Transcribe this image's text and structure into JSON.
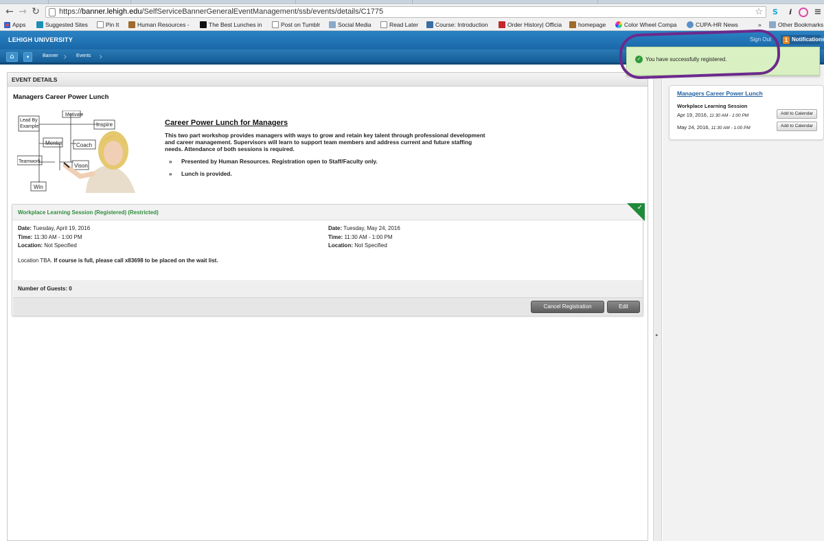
{
  "browser": {
    "url_prefix": "https://",
    "url_host": "banner.lehigh.edu",
    "url_path": "/SelfServiceBannerGeneralEventManagement/ssb/events/details/C1775",
    "bookmarks": [
      "Apps",
      "Suggested Sites",
      "Pin It",
      "Human Resources -",
      "The Best Lunches in",
      "Post on Tumblr",
      "Social Media",
      "Read Later",
      "Course: Introduction",
      "Order History| Officia",
      "homepage",
      "Color Wheel Compa",
      "CUPA-HR News"
    ],
    "overflow": "»",
    "other_bookmarks": "Other Bookmarks"
  },
  "header": {
    "brand": "LEHIGH UNIVERSITY",
    "signout": "Sign Out",
    "notification_count": "1",
    "notifications_label": "Notifications",
    "crumbs": [
      "Banner",
      "Events"
    ]
  },
  "notification": {
    "message": "You have successfully registered."
  },
  "panel": {
    "title": "EVENT DETAILS",
    "event_name": "Managers Career Power Lunch",
    "image_words": [
      "Motivate",
      "Lead By",
      "Example",
      "Inspire",
      "Mentor",
      "Coach",
      "Teamwork",
      "Vison",
      "Win"
    ],
    "promo": {
      "heading": "Career Power Lunch for Managers",
      "description": "This two part workshop provides managers with ways to grow and retain key talent through professional development and career management. Supervisors will learn to support team members and address current and future staffing needs. Attendance of both sessions is required.",
      "bullets": [
        "Presented by Human Resources. Registration open to Staff/Faculty only.",
        "Lunch is provided."
      ]
    }
  },
  "session": {
    "header": "Workplace Learning Session (Registered) (Restricted)",
    "labels": {
      "date": "Date:",
      "time": "Time:",
      "location": "Location:"
    },
    "meetings": [
      {
        "date": "Tuesday, April 19, 2016",
        "time": "11:30 AM - 1:00 PM",
        "location": "Not Specified"
      },
      {
        "date": "Tuesday, May 24, 2016",
        "time": "11:30 AM - 1:00 PM",
        "location": "Not Specified"
      }
    ],
    "note_plain": "Location TBA.",
    "note_bold": "If course is full, please call x83698 to be placed on the wait list.",
    "guests": "Number of Guests: 0",
    "cancel_label": "Cancel Registration",
    "edit_label": "Edit"
  },
  "sidebar": {
    "title": "Managers Career Power Lunch",
    "session_name": "Workplace Learning Session",
    "dates": [
      {
        "date": "Apr 19, 2016,",
        "time": "11:30 AM - 1:00 PM",
        "button": "Add to Calendar"
      },
      {
        "date": "May 24, 2016,",
        "time": "11:30 AM - 1:00 PM",
        "button": "Add to Calendar"
      }
    ]
  },
  "colors": {
    "header_blue": "#1a68a8",
    "success_green": "#2e8b3c",
    "link_blue": "#1f5f9e",
    "annotation_purple": "#6c2a8c"
  }
}
